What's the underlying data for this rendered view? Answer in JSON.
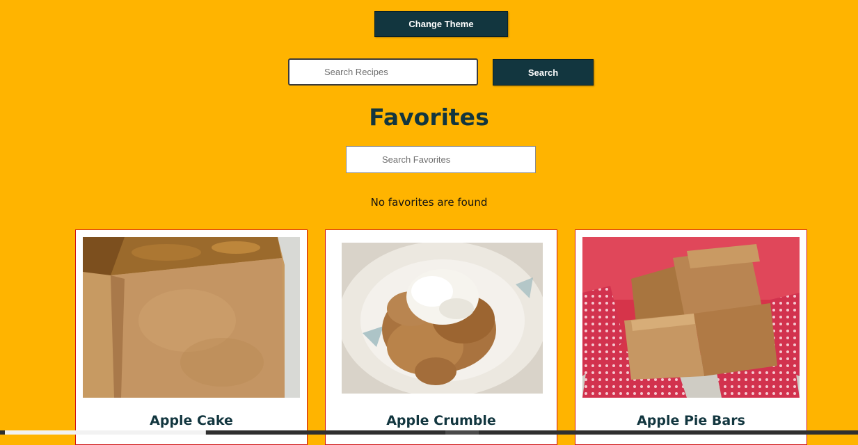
{
  "header": {
    "change_theme_label": "Change Theme"
  },
  "search": {
    "placeholder": "Search Recipes",
    "button_label": "Search"
  },
  "favorites": {
    "title": "Favorites",
    "search_placeholder": "Search Favorites",
    "empty_message": "No favorites are found"
  },
  "recipes": [
    {
      "title": "Apple Cake"
    },
    {
      "title": "Apple Crumble"
    },
    {
      "title": "Apple Pie Bars"
    }
  ],
  "colors": {
    "background": "#FFB400",
    "primary": "#12363F",
    "card_border": "#D11414"
  }
}
